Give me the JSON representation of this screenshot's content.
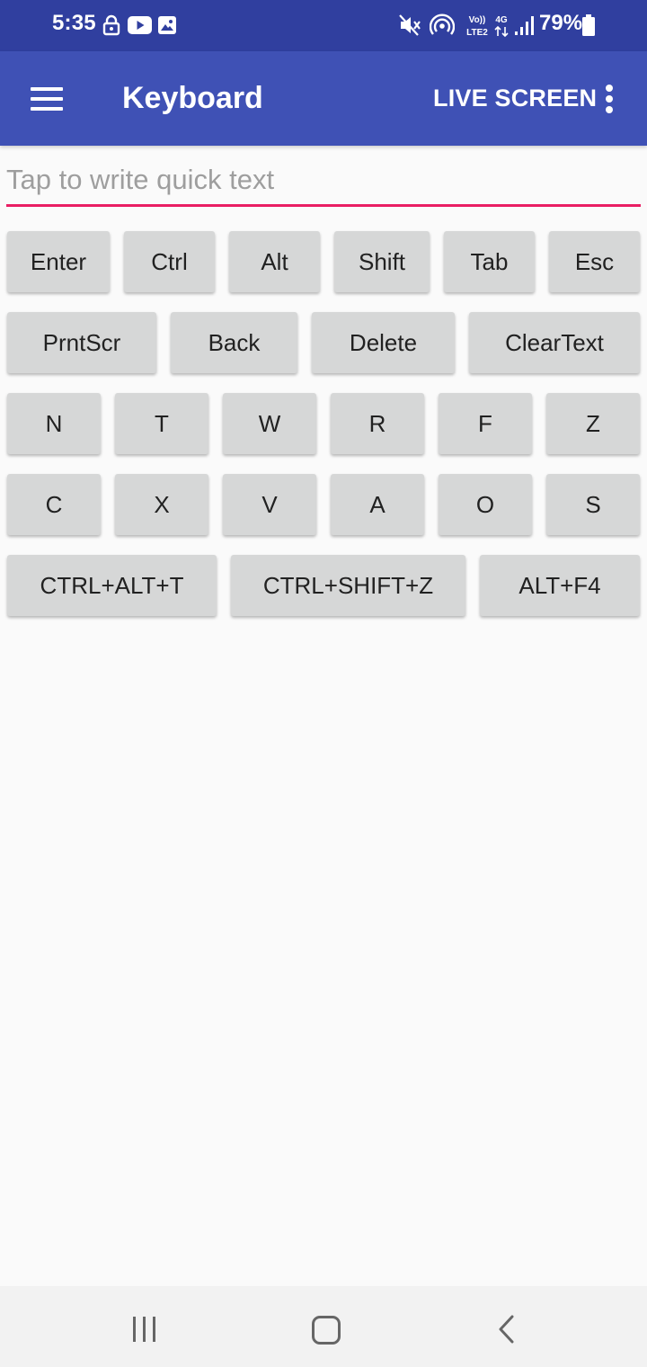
{
  "status_bar": {
    "time": "5:35",
    "battery": "79%",
    "network": "4G",
    "volte": "Vo)) LTE2",
    "icons": [
      "lock-icon",
      "youtube-icon",
      "image-icon",
      "mute-icon",
      "hotspot-icon",
      "volte-icon",
      "4g-icon",
      "signal-icon",
      "battery-icon"
    ]
  },
  "app_bar": {
    "title": "Keyboard",
    "live_screen_label": "LIVE SCREEN",
    "background": "#3f51b5",
    "status_background": "#303f9f"
  },
  "quick_text": {
    "placeholder": "Tap to write quick text",
    "value": "",
    "underline_color": "#e91e63"
  },
  "keys": {
    "row1": [
      "Enter",
      "Ctrl",
      "Alt",
      "Shift",
      "Tab",
      "Esc"
    ],
    "row2": [
      "PrntScr",
      "Back",
      "Delete",
      "ClearText"
    ],
    "row3": [
      "N",
      "T",
      "W",
      "R",
      "F",
      "Z"
    ],
    "row4": [
      "C",
      "X",
      "V",
      "A",
      "O",
      "S"
    ],
    "row5": [
      "CTRL+ALT+T",
      "CTRL+SHIFT+Z",
      "ALT+F4"
    ]
  },
  "nav_bar": {
    "icons": [
      "recents-icon",
      "home-icon",
      "back-icon"
    ]
  }
}
